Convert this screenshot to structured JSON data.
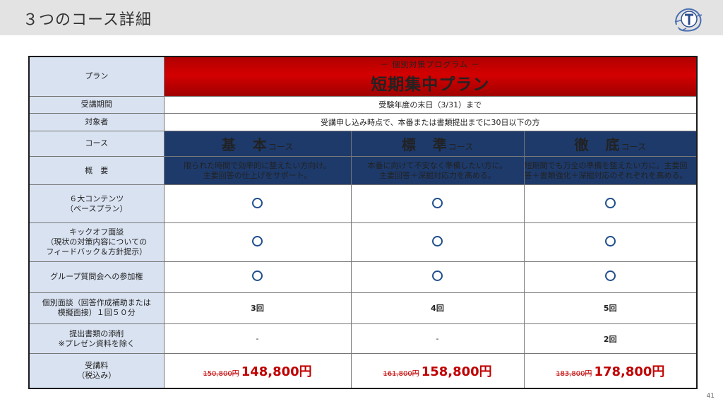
{
  "header": {
    "title": "３つのコース詳細"
  },
  "page_number": "41",
  "table": {
    "plan_label": "プラン",
    "plan_subtitle": "－ 個別対策プログラム －",
    "plan_name": "短期集中プラン",
    "period_label": "受講期間",
    "period_value": "受験年度の末日（3/31）まで",
    "target_label": "対象者",
    "target_value": "受講申し込み時点で、本番または書類提出までに30日以下の方",
    "course_label": "コース",
    "overview_label": "概　要",
    "courses": [
      {
        "name": "基　本",
        "suffix": "コース",
        "desc1": "限られた時間で効率的に整えたい方向け。",
        "desc2": "主要回答の仕上げをサポート。",
        "interview": "3回",
        "review": "-",
        "old_price": "150,800円",
        "price": "148,800円"
      },
      {
        "name": "標　準",
        "suffix": "コース",
        "desc1": "本番に向けて不安なく準備したい方に。",
        "desc2": "主要回答＋深掘対応力を高める。",
        "interview": "4回",
        "review": "-",
        "old_price": "161,800円",
        "price": "158,800円"
      },
      {
        "name": "徹　底",
        "suffix": "コース",
        "desc1": "短期間でも万全の準備を整えたい方に。主要回",
        "desc2": "答＋書類強化＋深掘対応のそれぞれを高める。",
        "interview": "5回",
        "review": "2回",
        "old_price": "183,800円",
        "price": "178,800円"
      }
    ],
    "rows": {
      "content_l1": "６大コンテンツ",
      "content_l2": "（ベースプラン）",
      "kickoff_l1": "キックオフ面談",
      "kickoff_l2": "（現状の対策内容についての",
      "kickoff_l3": "フィードバック＆方針提示）",
      "group_label": "グループ質問会への参加権",
      "interview_l1": "個別面談（回答作成補助または",
      "interview_l2": "模擬面接）１回５０分",
      "review_l1": "提出書類の添削",
      "review_l2": "※プレゼン資料を除く",
      "fee_l1": "受講料",
      "fee_l2": "（税込み）"
    }
  }
}
